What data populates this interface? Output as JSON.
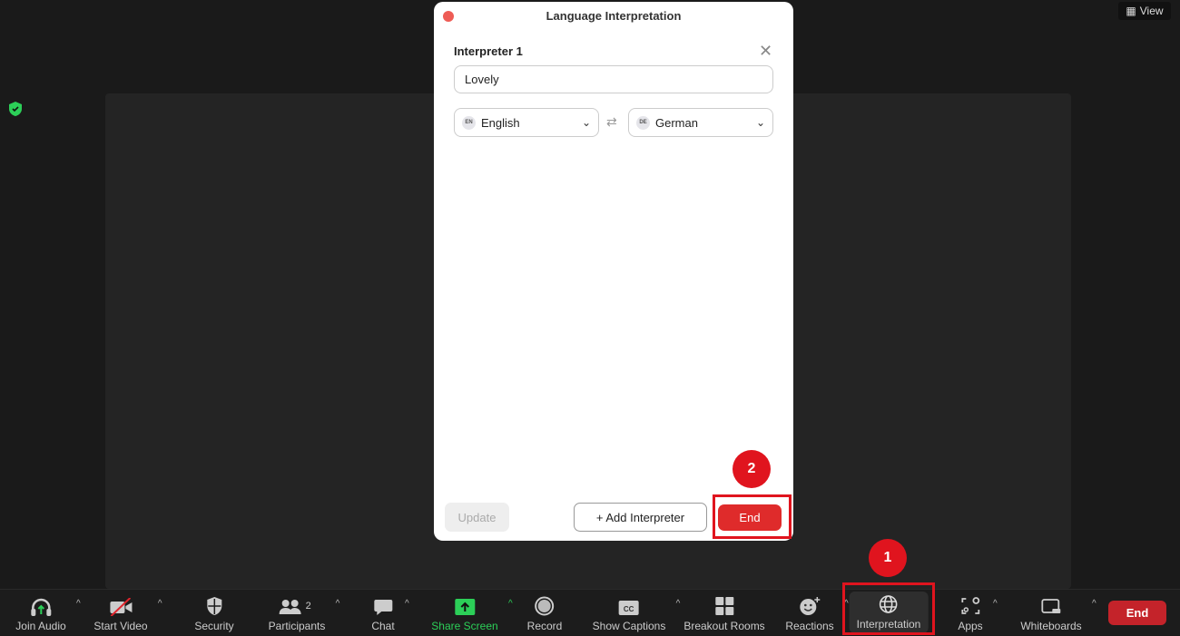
{
  "meeting": {
    "view_label": "View",
    "shield_color": "#2ccf58"
  },
  "dialog": {
    "title": "Language Interpretation",
    "interpreter_label": "Interpreter 1",
    "interpreter_name": "Lovely",
    "from_lang": {
      "code": "EN",
      "label": "English"
    },
    "to_lang": {
      "code": "DE",
      "label": "German"
    },
    "update_label": "Update",
    "add_label": "+ Add Interpreter",
    "end_label": "End"
  },
  "toolbar": {
    "items": [
      {
        "label": "Join Audio",
        "icon": "headphones-icon"
      },
      {
        "label": "Start Video",
        "icon": "video-off-icon"
      },
      {
        "label": "Security",
        "icon": "shield-icon"
      },
      {
        "label": "Participants",
        "icon": "participants-icon",
        "count": "2"
      },
      {
        "label": "Chat",
        "icon": "chat-icon"
      },
      {
        "label": "Share Screen",
        "icon": "share-screen-icon"
      },
      {
        "label": "Record",
        "icon": "record-icon"
      },
      {
        "label": "Show Captions",
        "icon": "cc-icon"
      },
      {
        "label": "Breakout Rooms",
        "icon": "breakout-icon"
      },
      {
        "label": "Reactions",
        "icon": "reactions-icon"
      },
      {
        "label": "Interpretation",
        "icon": "globe-icon"
      },
      {
        "label": "Apps",
        "icon": "apps-icon"
      },
      {
        "label": "Whiteboards",
        "icon": "whiteboard-icon"
      }
    ],
    "end_label": "End"
  },
  "annotations": {
    "step1": "1",
    "step2": "2",
    "color": "#e0141e"
  }
}
